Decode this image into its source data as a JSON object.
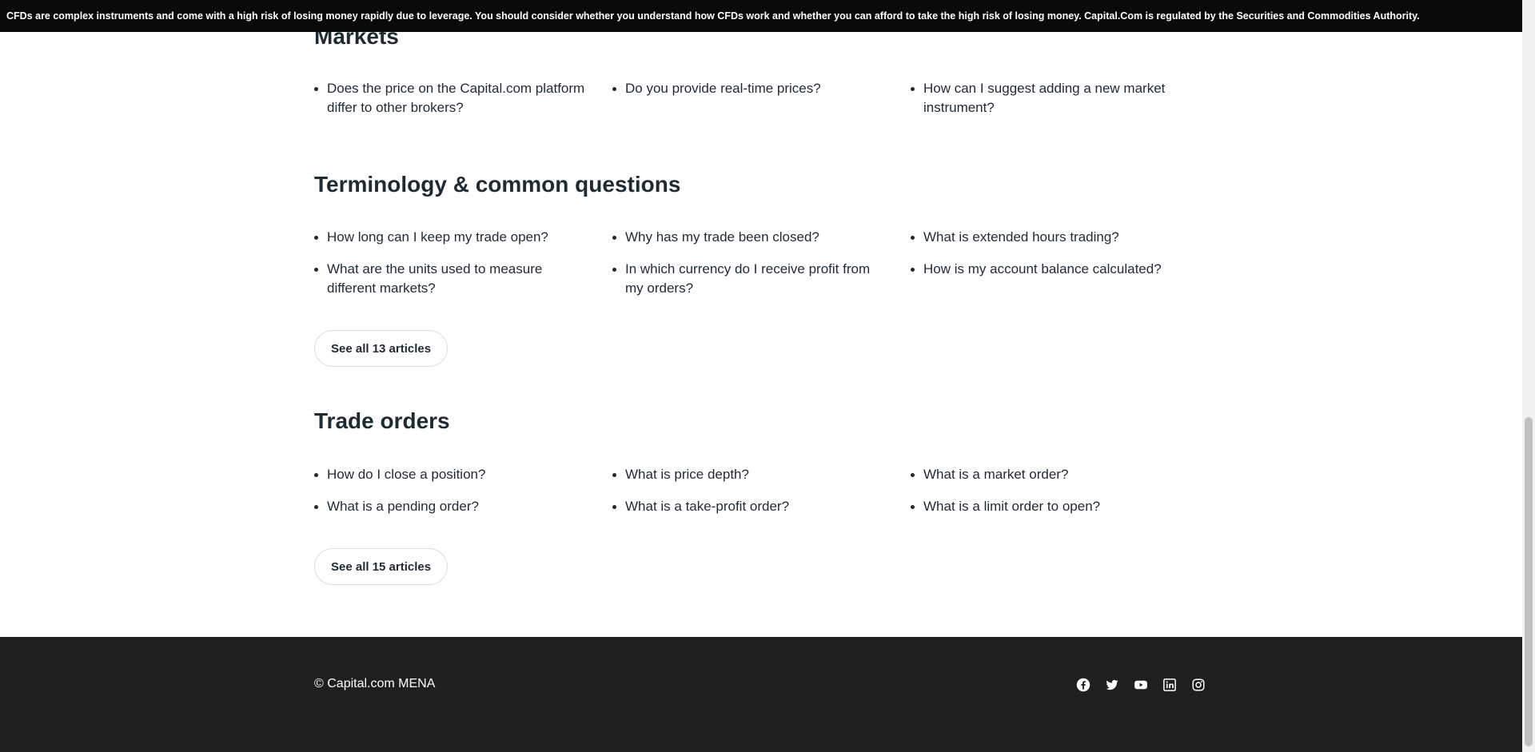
{
  "risk_banner": "CFDs are complex instruments and come with a high risk of losing money rapidly due to leverage. You should consider whether you understand how CFDs work and whether you can afford to take the high risk of losing money. Capital.Com is regulated by the Securities and Commodities Authority.",
  "sections": [
    {
      "title": "Markets",
      "articles": [
        "Does the price on the Capital.com platform differ to other brokers?",
        "Do you provide real-time prices?",
        "How can I suggest adding a new market instrument?"
      ]
    },
    {
      "title": "Terminology & common questions",
      "articles": [
        "How long can I keep my trade open?",
        "Why has my trade been closed?",
        "What is extended hours trading?",
        "What are the units used to measure different markets?",
        "In which currency do I receive profit from my orders?",
        "How is my account balance calculated?"
      ],
      "see_all_label": "See all 13 articles"
    },
    {
      "title": "Trade orders",
      "articles": [
        "How do I close a position?",
        "What is price depth?",
        "What is a market order?",
        "What is a pending order?",
        "What is a take-profit order?",
        "What is a limit order to open?"
      ],
      "see_all_label": "See all 15 articles"
    }
  ],
  "footer": {
    "copyright": "© Capital.com MENA",
    "social_icons": [
      "facebook-icon",
      "twitter-icon",
      "youtube-icon",
      "linkedin-icon",
      "instagram-icon"
    ]
  }
}
